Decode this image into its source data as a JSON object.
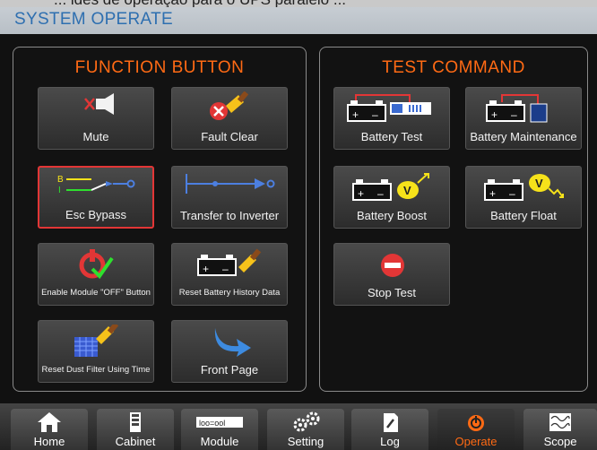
{
  "top_cut_text": "... ides de operação para o UPS paralelo ...",
  "header": {
    "title": "SYSTEM OPERATE"
  },
  "function_panel": {
    "title": "FUNCTION BUTTON",
    "buttons": [
      {
        "label": "Mute",
        "icon": "mute-speaker-icon"
      },
      {
        "label": "Fault Clear",
        "icon": "fault-clear-brush-icon"
      },
      {
        "label": "Esc Bypass",
        "icon": "esc-bypass-switch-icon",
        "selected": true
      },
      {
        "label": "Transfer to Inverter",
        "icon": "transfer-arrow-icon"
      },
      {
        "label": "Enable Module  \"OFF\" Button",
        "icon": "power-check-icon"
      },
      {
        "label": "Reset Battery History Data",
        "icon": "battery-brush-icon"
      },
      {
        "label": "Reset Dust Filter Using Time",
        "icon": "dust-filter-brush-icon"
      },
      {
        "label": "Front Page",
        "icon": "curved-arrow-icon"
      }
    ]
  },
  "test_panel": {
    "title": "TEST COMMAND",
    "buttons": [
      {
        "label": "Battery Test",
        "icon": "battery-test-icon"
      },
      {
        "label": "Battery Maintenance",
        "icon": "battery-maintenance-icon"
      },
      {
        "label": "Battery Boost",
        "icon": "battery-boost-icon",
        "badge": "V"
      },
      {
        "label": "Battery Float",
        "icon": "battery-float-icon",
        "badge": "V"
      },
      {
        "label": "Stop Test",
        "icon": "stop-icon"
      }
    ]
  },
  "nav": {
    "tabs": [
      {
        "label": "Home",
        "icon": "home-icon"
      },
      {
        "label": "Cabinet",
        "icon": "cabinet-icon"
      },
      {
        "label": "Module",
        "icon": "module-icon",
        "icon_text": "lοο=οοl"
      },
      {
        "label": "Setting",
        "icon": "settings-gears-icon"
      },
      {
        "label": "Log",
        "icon": "log-icon"
      },
      {
        "label": "Operate",
        "icon": "power-icon",
        "active": true
      },
      {
        "label": "Scope",
        "icon": "scope-icon"
      }
    ]
  },
  "colors": {
    "accent": "#ff6a14",
    "title_blue": "#2e6fb0",
    "selected_border": "#e23636"
  }
}
